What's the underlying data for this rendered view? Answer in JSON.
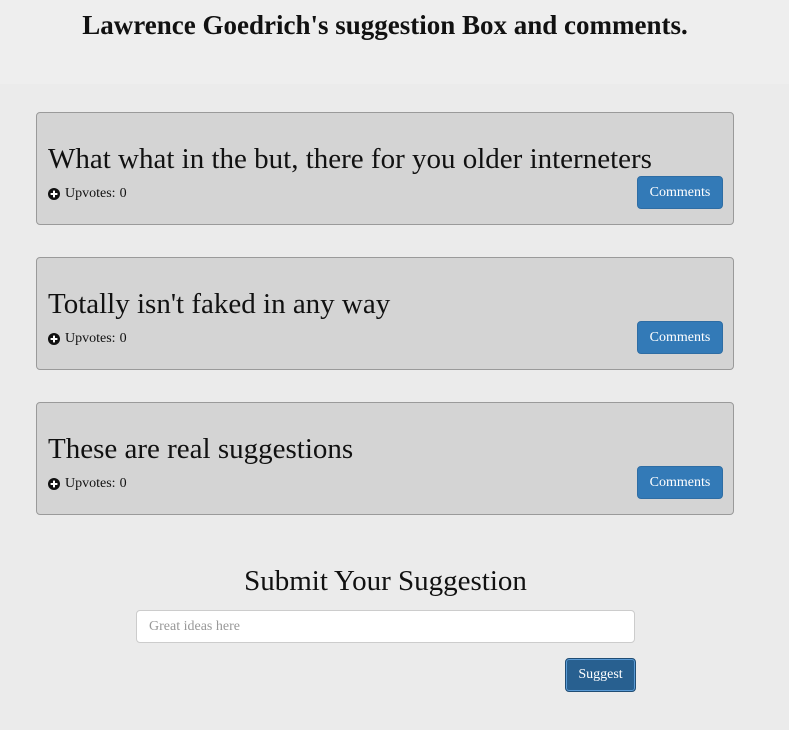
{
  "header": {
    "title": "Lawrence Goedrich's suggestion Box and comments."
  },
  "suggestions": [
    {
      "text": "What what in the but, there for you older interneters",
      "upvote_label": "Upvotes:",
      "upvotes": "0",
      "comments_label": "Comments"
    },
    {
      "text": "Totally isn't faked in any way",
      "upvote_label": "Upvotes:",
      "upvotes": "0",
      "comments_label": "Comments"
    },
    {
      "text": "These are real suggestions",
      "upvote_label": "Upvotes:",
      "upvotes": "0",
      "comments_label": "Comments"
    }
  ],
  "submit": {
    "heading": "Submit Your Suggestion",
    "placeholder": "Great ideas here",
    "value": "",
    "button_label": "Suggest"
  },
  "icons": {
    "upvote": "plus-circle-icon"
  },
  "colors": {
    "comments_button": "#337ab7",
    "suggest_button": "#286090",
    "card_background": "#d4d4d4",
    "page_background": "#ebebeb"
  }
}
